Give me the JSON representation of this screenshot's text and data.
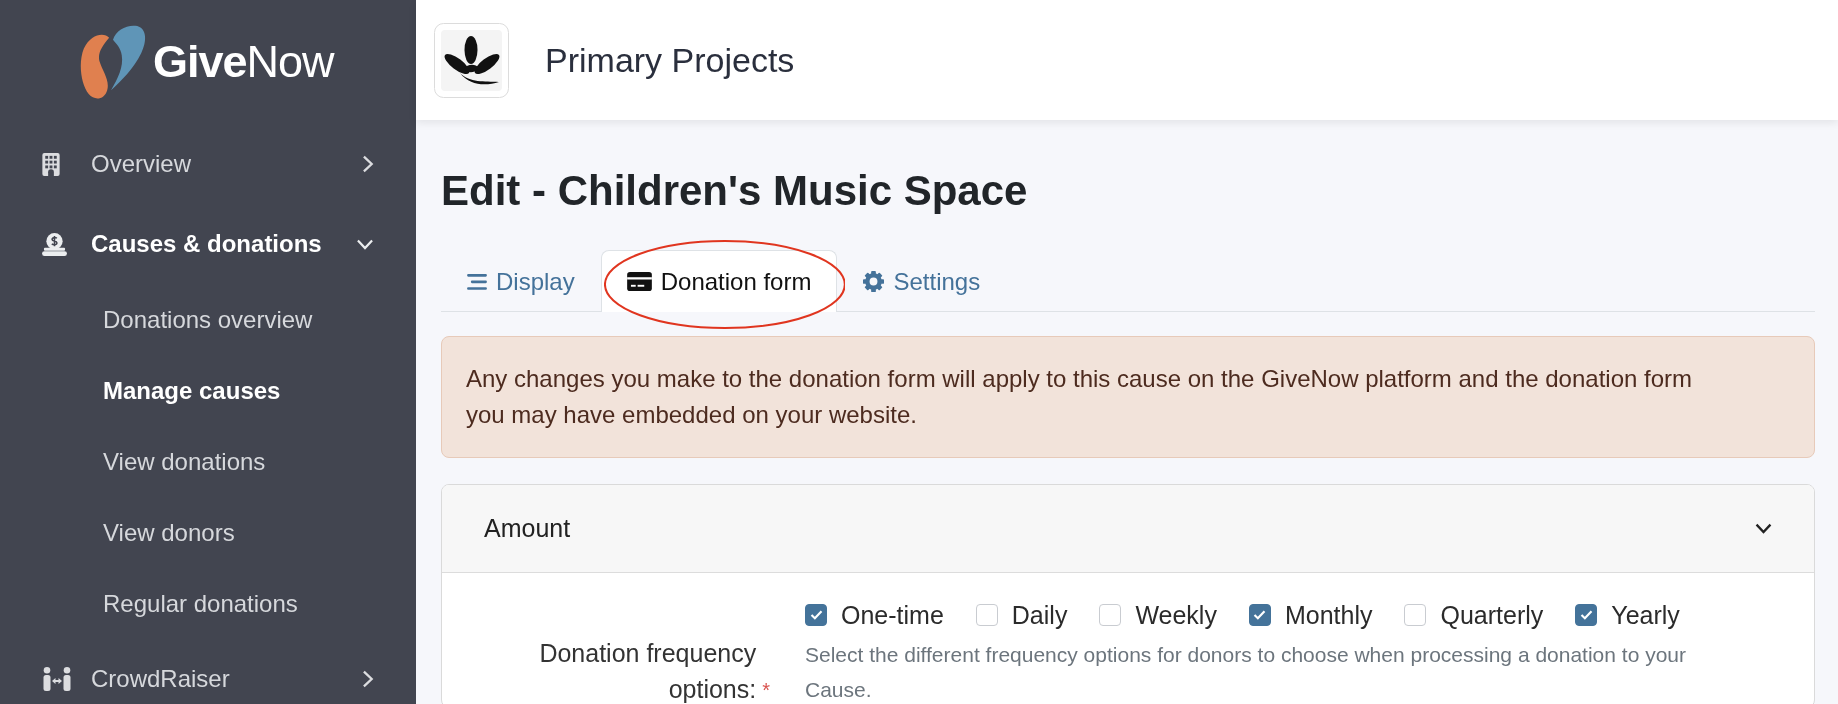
{
  "sidebar": {
    "logo": {
      "text": "**Give**Now"
    },
    "items": [
      {
        "label": "Overview",
        "selected": false,
        "expanded": false
      },
      {
        "label": "Causes & donations",
        "selected": true,
        "expanded": true,
        "children": [
          {
            "label": "Donations overview",
            "selected": false
          },
          {
            "label": "Manage causes",
            "selected": true
          },
          {
            "label": "View donations",
            "selected": false
          },
          {
            "label": "View donors",
            "selected": false
          },
          {
            "label": "Regular donations",
            "selected": false
          }
        ]
      },
      {
        "label": "CrowdRaiser",
        "selected": false,
        "expanded": false
      }
    ]
  },
  "header": {
    "organization": "Primary Projects"
  },
  "page": {
    "title": "Edit - Children's Music Space"
  },
  "tabs": [
    {
      "label": "Display",
      "selected": false,
      "highlighted": false
    },
    {
      "label": "Donation form",
      "selected": true,
      "highlighted": true
    },
    {
      "label": "Settings",
      "selected": false,
      "highlighted": false
    }
  ],
  "alert": {
    "text": "Any changes you make to the donation form will apply to this cause on the GiveNow platform and the donation form you may have embedded on your website."
  },
  "sections": [
    {
      "title": "Amount",
      "expanded": true,
      "fields": [
        {
          "label": "Donation frequency options:",
          "required_mark": "*",
          "options": [
            {
              "label": "One-time",
              "checked": true
            },
            {
              "label": "Daily",
              "checked": false
            },
            {
              "label": "Weekly",
              "checked": false
            },
            {
              "label": "Monthly",
              "checked": true
            },
            {
              "label": "Quarterly",
              "checked": false
            },
            {
              "label": "Yearly",
              "checked": true
            }
          ],
          "help": "Select the different frequency options for donors to choose when processing a donation to your Cause."
        }
      ]
    }
  ]
}
